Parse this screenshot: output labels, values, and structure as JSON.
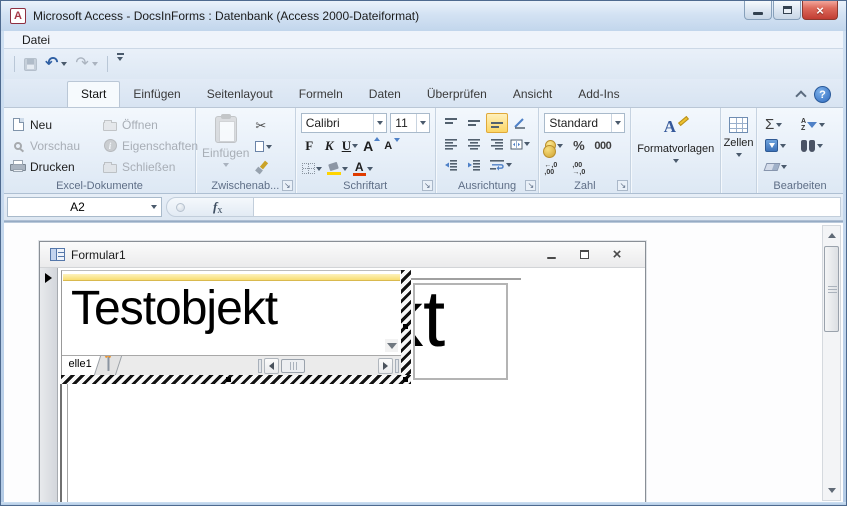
{
  "window": {
    "title": "Microsoft Access - DocsInForms : Datenbank (Access 2000-Dateiformat)"
  },
  "menubar": {
    "items": [
      {
        "label": "Datei"
      }
    ]
  },
  "icons": {
    "access_logo": "A",
    "close": "×",
    "help": "?",
    "undo": "↶",
    "redo": "↷",
    "cut": "✂",
    "launcher": "↘",
    "sigma": "Σ",
    "sort_a": "A",
    "sort_z": "Z",
    "info": "i",
    "grow_a": "A",
    "shrink_a": "A",
    "color_a": "A",
    "styles_a": "A",
    "fx_f": "f",
    "fx_x": "x"
  },
  "ribbon": {
    "tabs": [
      {
        "label": "Start",
        "active": true
      },
      {
        "label": "Einfügen"
      },
      {
        "label": "Seitenlayout"
      },
      {
        "label": "Formeln"
      },
      {
        "label": "Daten"
      },
      {
        "label": "Überprüfen"
      },
      {
        "label": "Ansicht"
      },
      {
        "label": "Add-Ins"
      }
    ],
    "groups": {
      "documents": {
        "label": "Excel-Dokumente",
        "buttons": [
          {
            "label": "Neu",
            "enabled": true
          },
          {
            "label": "Öffnen",
            "enabled": false
          },
          {
            "label": "Vorschau",
            "enabled": false
          },
          {
            "label": "Eigenschaften",
            "enabled": false
          },
          {
            "label": "Drucken",
            "enabled": true
          },
          {
            "label": "Schließen",
            "enabled": false
          }
        ]
      },
      "clipboard": {
        "label": "Zwischenab...",
        "paste": "Einfügen"
      },
      "font": {
        "label": "Schriftart",
        "family": "Calibri",
        "size": "11",
        "bold": "F",
        "italic": "K",
        "underline": "U"
      },
      "alignment": {
        "label": "Ausrichtung"
      },
      "number": {
        "label": "Zahl",
        "format": "Standard",
        "percent": "%",
        "thousands": "000",
        "inc_dec": [
          "←,0",
          ",00"
        ],
        "dec_dec": [
          ",00",
          "→,0"
        ]
      },
      "styles": {
        "label": "Formatvorlagen"
      },
      "cells": {
        "label": "Zellen"
      },
      "editing": {
        "label": "Bearbeiten"
      }
    }
  },
  "formula_bar": {
    "name_box": "A2"
  },
  "document": {
    "form": {
      "title": "Formular1"
    },
    "sheet": {
      "cell_text": "Testobjekt",
      "tab": "elle1"
    },
    "frame_text": "kt"
  },
  "colors": {
    "selection_yellow": "#f9dd71",
    "ribbon_highlight": "#fcd665",
    "close_red": "#c13d33",
    "help_blue": "#2f6bbf",
    "fill_yellow": "#ffd400",
    "font_red": "#e03c00"
  }
}
